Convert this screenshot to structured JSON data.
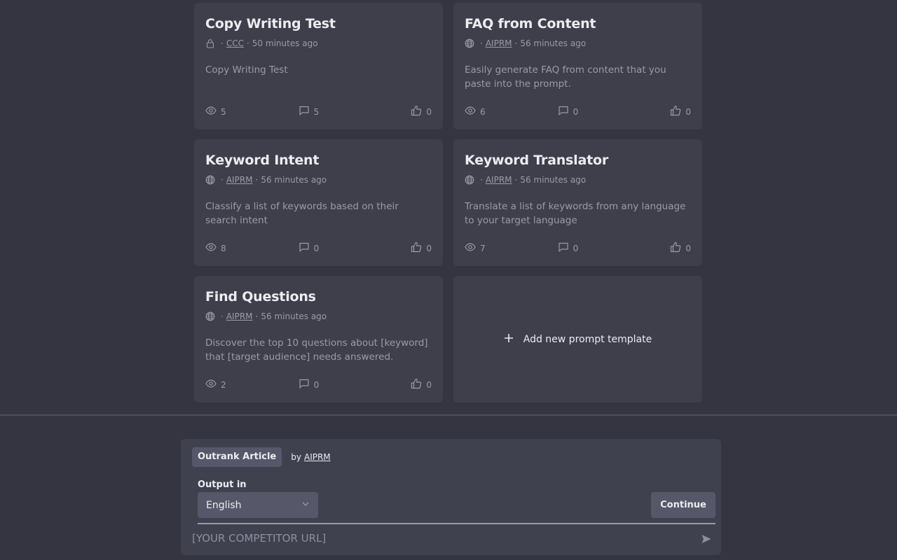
{
  "cards": [
    {
      "title": "Copy Writing Test",
      "visibility_icon": "lock-icon",
      "author": "CCC",
      "time": "50 minutes ago",
      "description": "Copy Writing Test",
      "views": "5",
      "comments": "5",
      "likes": "0"
    },
    {
      "title": "FAQ from Content",
      "visibility_icon": "globe-icon",
      "author": "AIPRM",
      "time": "56 minutes ago",
      "description": "Easily generate FAQ from content that you paste into the prompt.",
      "views": "6",
      "comments": "0",
      "likes": "0"
    },
    {
      "title": "Keyword Intent",
      "visibility_icon": "globe-icon",
      "author": "AIPRM",
      "time": "56 minutes ago",
      "description": "Classify a list of keywords based on their search intent",
      "views": "8",
      "comments": "0",
      "likes": "0"
    },
    {
      "title": "Keyword Translator",
      "visibility_icon": "globe-icon",
      "author": "AIPRM",
      "time": "56 minutes ago",
      "description": "Translate a list of keywords from any language to your target language",
      "views": "7",
      "comments": "0",
      "likes": "0"
    },
    {
      "title": "Find Questions",
      "visibility_icon": "globe-icon",
      "author": "AIPRM",
      "time": "56 minutes ago",
      "description": "Discover the top 10 questions about [keyword] that [target audience] needs answered.",
      "views": "2",
      "comments": "0",
      "likes": "0"
    }
  ],
  "meta_separator": "·",
  "add_card": {
    "label": "Add new prompt template"
  },
  "composer": {
    "selected_template": "Outrank Article",
    "by_label": "by",
    "author": "AIPRM",
    "output_label": "Output in",
    "language": "English",
    "continue_label": "Continue",
    "input_value": "",
    "input_placeholder": "[YOUR COMPETITOR URL]"
  }
}
